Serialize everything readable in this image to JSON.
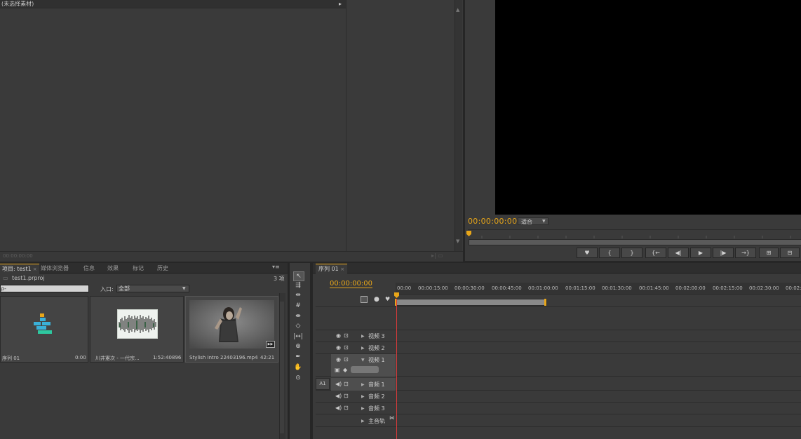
{
  "source_monitor": {
    "header_title": "(未选择素材)",
    "timecode": "00:00:00:00"
  },
  "program_monitor": {
    "timecode": "00:00:00:00",
    "fit_label": "适合",
    "controls": [
      "marker",
      "in-point",
      "out-point",
      "go-to-in",
      "step-back",
      "play",
      "step-forward",
      "go-to-out",
      "lift",
      "extract"
    ]
  },
  "project_panel": {
    "tabs": [
      {
        "label": "项目: test1",
        "active": true
      },
      {
        "label": "媒体浏览器",
        "active": false
      },
      {
        "label": "信息",
        "active": false
      },
      {
        "label": "效果",
        "active": false
      },
      {
        "label": "标记",
        "active": false
      },
      {
        "label": "历史",
        "active": false
      }
    ],
    "project_file": "test1.prproj",
    "item_count": "3 项",
    "search_placeholder": "ρ-",
    "entry_label": "入口:",
    "entry_value": "全部",
    "items": [
      {
        "name": "序列 01",
        "duration": "0:00"
      },
      {
        "name": "川井憲次 - 一代宗...",
        "duration": "1:52:40896"
      },
      {
        "name": "Stylish Intro 22403196.mp4",
        "duration": "42:21"
      }
    ]
  },
  "tools": {
    "icons": [
      "selection-tool-icon",
      "track-select-tool-icon",
      "ripple-edit-tool-icon",
      "rolling-edit-tool-icon",
      "rate-stretch-tool-icon",
      "razor-tool-icon",
      "slip-tool-icon",
      "slide-tool-icon",
      "pen-tool-icon",
      "hand-tool-icon",
      "zoom-tool-icon"
    ]
  },
  "timeline": {
    "tab_label": "序列 01",
    "timecode": "00:00:00:00",
    "ruler_labels": [
      "00:00",
      "00:00:15:00",
      "00:00:30:00",
      "00:00:45:00",
      "00:01:00:00",
      "00:01:15:00",
      "00:01:30:00",
      "00:01:45:00",
      "00:02:00:00",
      "00:02:15:00",
      "00:02:30:00",
      "00:02:"
    ],
    "tracks": [
      {
        "name": "视频 3",
        "kind": "video"
      },
      {
        "name": "视频 2",
        "kind": "video"
      },
      {
        "name": "视频 1",
        "kind": "video"
      },
      {
        "name": "音频 1",
        "kind": "audio",
        "source_label": "A1"
      },
      {
        "name": "音频 2",
        "kind": "audio"
      },
      {
        "name": "音频 3",
        "kind": "audio"
      },
      {
        "name": "主音轨",
        "kind": "master"
      }
    ]
  },
  "colors": {
    "accent": "#e8a619",
    "panel": "#3a3a3a",
    "playhead_line": "#d83a3a"
  }
}
